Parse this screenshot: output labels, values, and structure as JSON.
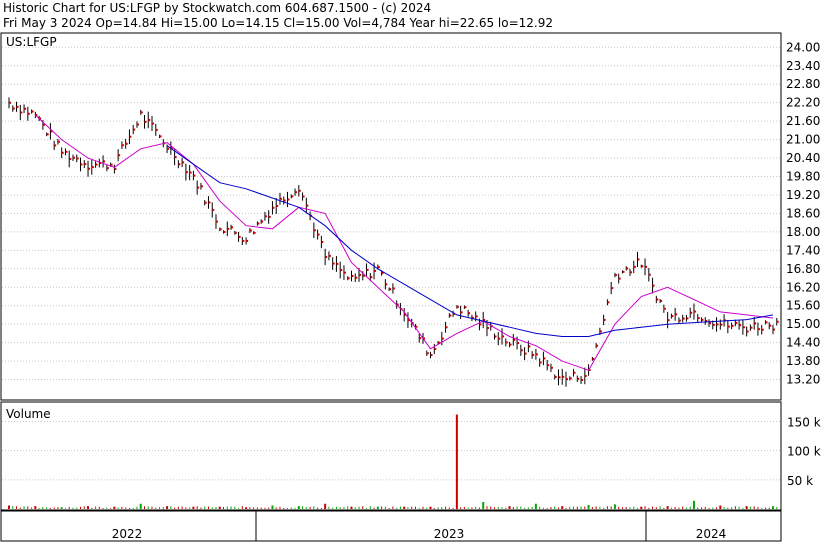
{
  "header": {
    "line1": "Historic Chart for US:LFGP by Stockwatch.com 604.687.1500 - (c) 2024",
    "line2": "Fri May  3 2024  Op=14.84  Hi=15.00  Lo=14.15  Cl=15.00  Vol=4,784  Year hi=22.65  lo=12.92"
  },
  "colors": {
    "price_bar": "#000000",
    "close_tick": "#cc0000",
    "ma_short": "#cc00cc",
    "ma_long": "#0000cc",
    "volume_up": "#00aa00",
    "volume_down": "#cc0000",
    "grid": "#c8c8c8",
    "frame": "#000000"
  },
  "chart_data": [
    {
      "type": "line",
      "panel": "price",
      "title": "US:LFGP",
      "x_labels": [
        "2022",
        "2023",
        "2024"
      ],
      "y_ticks": [
        "24.00",
        "23.40",
        "22.80",
        "22.20",
        "21.60",
        "21.00",
        "20.40",
        "19.80",
        "19.20",
        "18.60",
        "18.00",
        "17.40",
        "16.80",
        "16.20",
        "15.60",
        "15.00",
        "14.40",
        "13.80",
        "13.20"
      ],
      "ylim": [
        12.6,
        24.4
      ],
      "grid": true,
      "x": [
        "2021-12",
        "2022-01",
        "2022-02",
        "2022-03",
        "2022-04",
        "2022-05",
        "2022-06",
        "2022-07",
        "2022-08",
        "2022-09",
        "2022-10",
        "2022-11",
        "2022-12",
        "2023-01",
        "2023-02",
        "2023-03",
        "2023-04",
        "2023-05",
        "2023-06",
        "2023-07",
        "2023-08",
        "2023-09",
        "2023-10",
        "2023-11",
        "2023-12",
        "2024-01",
        "2024-02",
        "2024-03",
        "2024-04",
        "2024-05"
      ],
      "series": [
        {
          "style": "price_bars",
          "values": [
            22.2,
            21.8,
            20.6,
            20.2,
            20.2,
            21.8,
            20.8,
            19.8,
            18.2,
            17.8,
            18.8,
            19.5,
            17.2,
            16.4,
            16.8,
            15.4,
            14.0,
            15.6,
            15.0,
            14.4,
            14.0,
            13.2,
            13.4,
            16.6,
            17.0,
            15.2,
            15.4,
            15.0,
            14.9,
            15.0
          ]
        },
        {
          "style": "moving_average_short",
          "values": [
            null,
            21.8,
            21.0,
            20.4,
            20.1,
            20.7,
            20.9,
            20.2,
            19.0,
            18.2,
            18.1,
            18.8,
            18.6,
            17.0,
            16.2,
            15.4,
            14.2,
            14.7,
            15.1,
            14.6,
            14.3,
            13.8,
            13.5,
            15.0,
            15.9,
            16.2,
            15.8,
            15.4,
            15.3,
            15.2
          ]
        },
        {
          "style": "moving_average_long",
          "values": [
            null,
            null,
            null,
            null,
            null,
            null,
            20.8,
            20.2,
            19.6,
            19.4,
            19.1,
            18.8,
            18.2,
            17.4,
            16.8,
            16.3,
            15.8,
            15.3,
            15.1,
            14.9,
            14.7,
            14.6,
            14.6,
            14.8,
            14.9,
            15.0,
            15.05,
            15.1,
            15.15,
            15.3
          ]
        }
      ]
    },
    {
      "type": "bar",
      "panel": "volume",
      "title": "Volume",
      "y_ticks": [
        "150 k",
        "100 k",
        "50 k"
      ],
      "ylim": [
        0,
        180000
      ],
      "x": [
        "2021-12",
        "2022-01",
        "2022-02",
        "2022-03",
        "2022-04",
        "2022-05",
        "2022-06",
        "2022-07",
        "2022-08",
        "2022-09",
        "2022-10",
        "2022-11",
        "2022-12",
        "2023-01",
        "2023-02",
        "2023-03",
        "2023-04",
        "2023-05",
        "2023-06",
        "2023-07",
        "2023-08",
        "2023-09",
        "2023-10",
        "2023-11",
        "2023-12",
        "2024-01",
        "2024-02",
        "2024-03",
        "2024-04",
        "2024-05"
      ],
      "values": [
        6000,
        5000,
        3000,
        5000,
        4000,
        9000,
        5000,
        4000,
        4000,
        3000,
        6000,
        5000,
        9000,
        4000,
        4000,
        4000,
        4000,
        162000,
        12000,
        5000,
        9000,
        5000,
        7000,
        8000,
        4000,
        5000,
        14000,
        6000,
        5000,
        4784
      ],
      "direction": [
        "down",
        "down",
        "up",
        "down",
        "down",
        "up",
        "down",
        "down",
        "down",
        "down",
        "up",
        "up",
        "down",
        "down",
        "up",
        "down",
        "down",
        "down",
        "up",
        "down",
        "up",
        "down",
        "up",
        "up",
        "down",
        "down",
        "up",
        "down",
        "down",
        "up"
      ]
    }
  ]
}
